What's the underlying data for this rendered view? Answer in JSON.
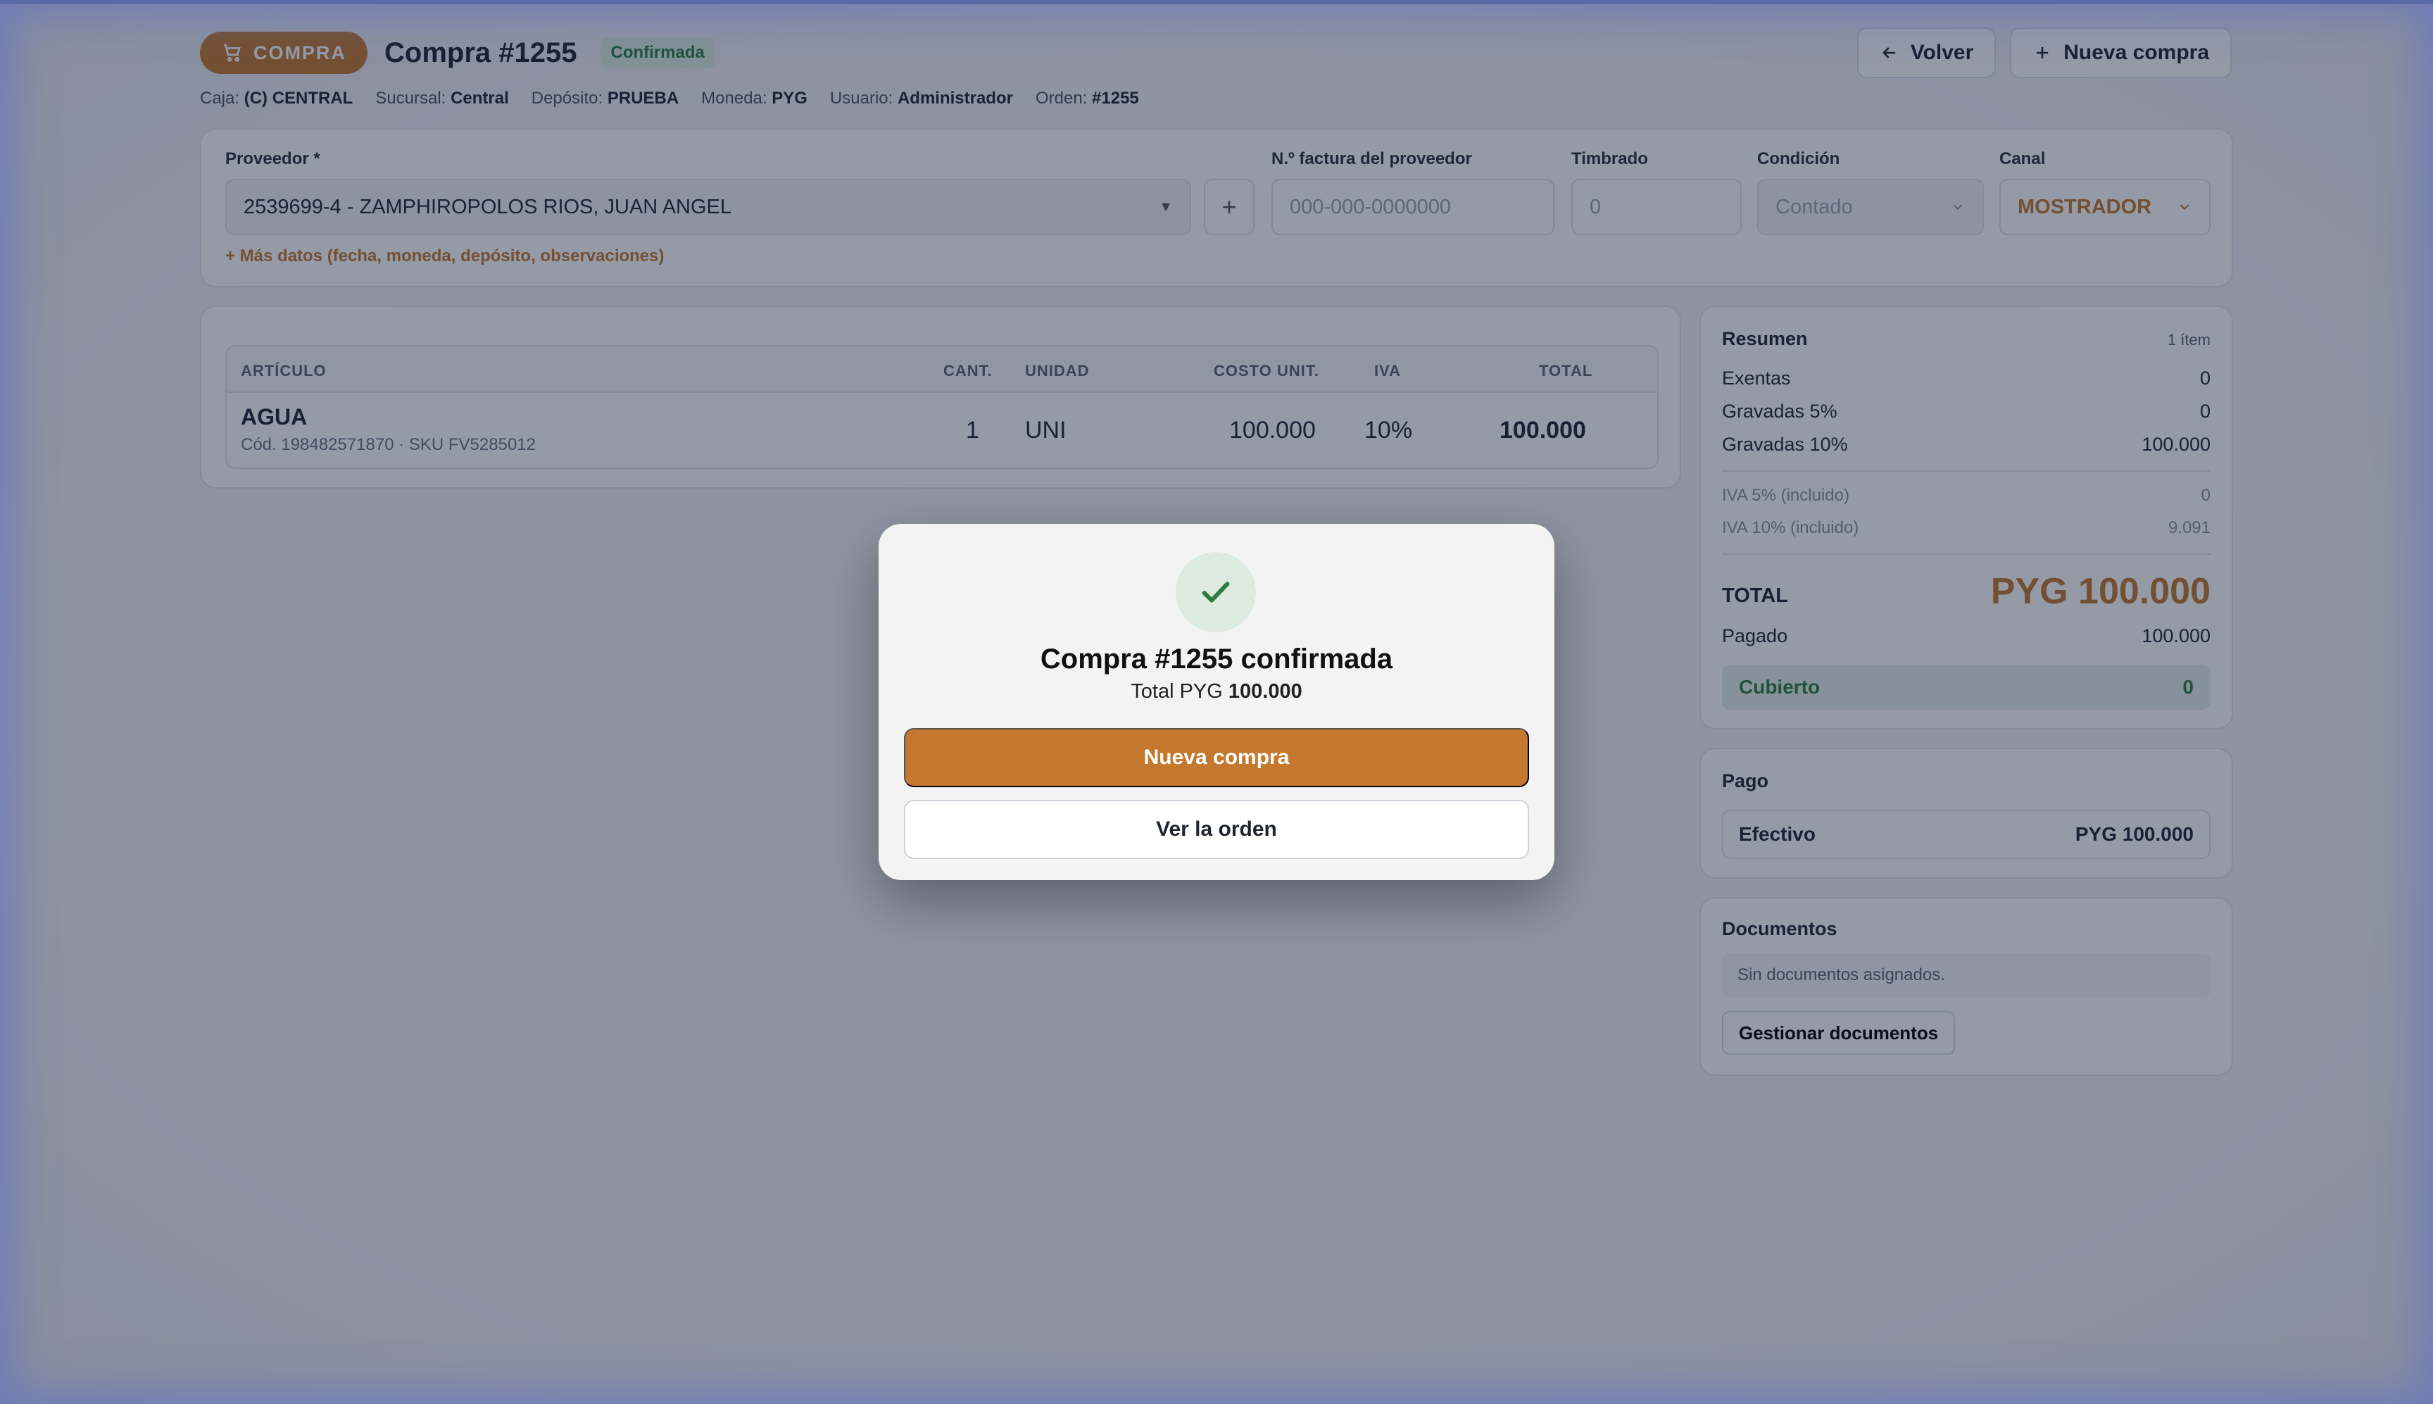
{
  "header": {
    "pill_label": "COMPRA",
    "title": "Compra #1255",
    "status": "Confirmada",
    "back_label": "Volver",
    "new_label": "Nueva compra"
  },
  "meta": {
    "caja_label": "Caja:",
    "caja": "(C) CENTRAL",
    "sucursal_label": "Sucursal:",
    "sucursal": "Central",
    "deposito_label": "Depósito:",
    "deposito": "PRUEBA",
    "moneda_label": "Moneda:",
    "moneda": "PYG",
    "usuario_label": "Usuario:",
    "usuario": "Administrador",
    "orden_label": "Orden:",
    "orden": "#1255"
  },
  "supplier": {
    "proveedor_label": "Proveedor *",
    "proveedor_value": "2539699-4 - ZAMPHIROPOLOS RIOS, JUAN ANGEL",
    "factura_label": "N.º factura del proveedor",
    "factura_placeholder": "000-000-0000000",
    "timbrado_label": "Timbrado",
    "timbrado_placeholder": "0",
    "condicion_label": "Condición",
    "condicion_value": "Contado",
    "canal_label": "Canal",
    "canal_value": "MOSTRADOR",
    "more_link": "+ Más datos (fecha, moneda, depósito, observaciones)",
    "add_symbol": "+"
  },
  "table": {
    "headers": {
      "articulo": "ARTÍCULO",
      "cant": "CANT.",
      "unidad": "UNIDAD",
      "costo": "COSTO UNIT.",
      "iva": "IVA",
      "total": "TOTAL"
    },
    "rows": [
      {
        "name": "AGUA",
        "sub": "Cód. 198482571870 · SKU FV5285012",
        "cant": "1",
        "unidad": "UNI",
        "costo": "100.000",
        "iva": "10%",
        "total": "100.000"
      }
    ]
  },
  "summary": {
    "title": "Resumen",
    "count": "1 ítem",
    "exentas_label": "Exentas",
    "exentas": "0",
    "g5_label": "Gravadas 5%",
    "g5": "0",
    "g10_label": "Gravadas 10%",
    "g10": "100.000",
    "iva5_label": "IVA 5% (incluido)",
    "iva5": "0",
    "iva10_label": "IVA 10% (incluido)",
    "iva10": "9.091",
    "total_label": "TOTAL",
    "total": "PYG 100.000",
    "pagado_label": "Pagado",
    "pagado": "100.000",
    "cubierto_label": "Cubierto",
    "cubierto": "0"
  },
  "pago": {
    "title": "Pago",
    "method": "Efectivo",
    "amount": "PYG 100.000"
  },
  "docs": {
    "title": "Documentos",
    "empty": "Sin documentos asignados.",
    "manage": "Gestionar documentos"
  },
  "modal": {
    "title": "Compra #1255 confirmada",
    "sub_prefix": "Total PYG",
    "sub_amount": "100.000",
    "primary": "Nueva compra",
    "secondary": "Ver la orden"
  },
  "colors": {
    "accent": "#c4782d",
    "success": "#2f7a3f",
    "overlay": "#1e2a4a"
  }
}
